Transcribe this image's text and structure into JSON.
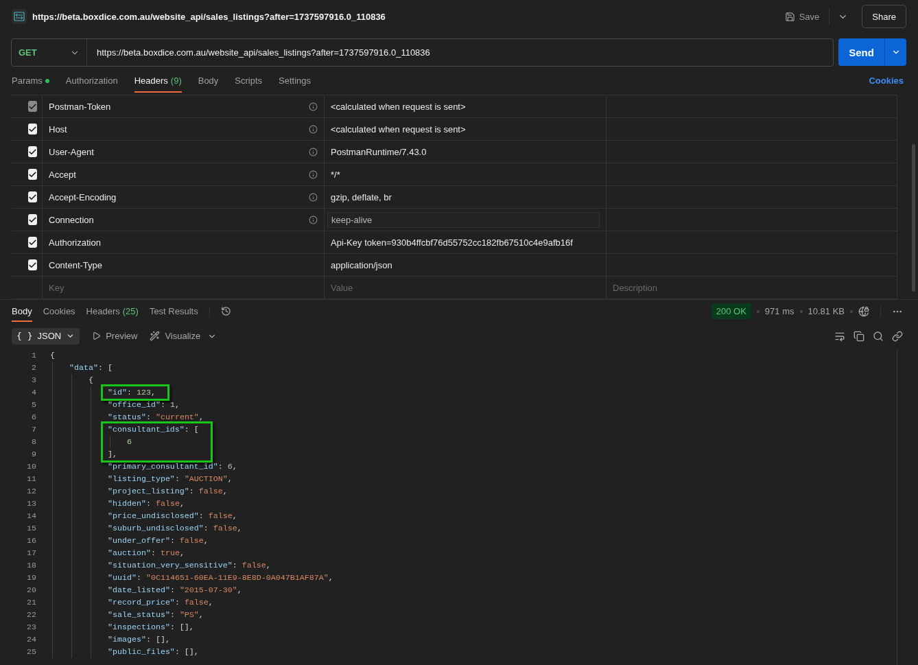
{
  "request_title": {
    "url": "https://beta.boxdice.com.au/website_api/sales_listings?after=1737597916.0_110836"
  },
  "actions": {
    "save": "Save",
    "share": "Share"
  },
  "url_bar": {
    "method": "GET",
    "url": "https://beta.boxdice.com.au/website_api/sales_listings?after=1737597916.0_110836",
    "send": "Send"
  },
  "request_tabs": [
    {
      "label": "Params",
      "dot": true,
      "selected": false
    },
    {
      "label": "Authorization",
      "dot": false,
      "selected": false
    },
    {
      "label": "Headers",
      "count": "(9)",
      "dot": false,
      "selected": true
    },
    {
      "label": "Body",
      "dot": false,
      "selected": false
    },
    {
      "label": "Scripts",
      "dot": false,
      "selected": false
    },
    {
      "label": "Settings",
      "dot": false,
      "selected": false
    }
  ],
  "cookies_link": "Cookies",
  "headers_table": {
    "rows": [
      {
        "checked": true,
        "disabled": true,
        "key": "Postman-Token",
        "info": true,
        "value": "<calculated when request is sent>",
        "editing": false
      },
      {
        "checked": true,
        "disabled": false,
        "key": "Host",
        "info": true,
        "value": "<calculated when request is sent>",
        "editing": false
      },
      {
        "checked": true,
        "disabled": false,
        "key": "User-Agent",
        "info": true,
        "value": "PostmanRuntime/7.43.0",
        "editing": false
      },
      {
        "checked": true,
        "disabled": false,
        "key": "Accept",
        "info": true,
        "value": "*/*",
        "editing": false
      },
      {
        "checked": true,
        "disabled": false,
        "key": "Accept-Encoding",
        "info": true,
        "value": "gzip, deflate, br",
        "editing": false
      },
      {
        "checked": true,
        "disabled": false,
        "key": "Connection",
        "info": true,
        "value": "keep-alive",
        "editing": true
      },
      {
        "checked": true,
        "disabled": false,
        "key": "Authorization",
        "info": false,
        "value": "Api-Key token=930b4ffcbf76d55752cc182fb67510c4e9afb16f",
        "editing": false
      },
      {
        "checked": true,
        "disabled": false,
        "key": "Content-Type",
        "info": false,
        "value": "application/json",
        "editing": false
      }
    ],
    "placeholders": {
      "key": "Key",
      "value": "Value",
      "description": "Description"
    }
  },
  "response_tabs": [
    {
      "label": "Body",
      "selected": true
    },
    {
      "label": "Cookies",
      "selected": false
    },
    {
      "label": "Headers",
      "count": "(25)",
      "selected": false
    },
    {
      "label": "Test Results",
      "selected": false
    }
  ],
  "response_status": {
    "code": "200 OK",
    "time": "971 ms",
    "size": "10.81 KB"
  },
  "view_toolbar": {
    "format_glyph": "{ }",
    "format": "JSON",
    "preview": "Preview",
    "visualize": "Visualize"
  },
  "code_lines": [
    {
      "number": "1",
      "boxed": false,
      "tokens": [
        {
          "kind": "punct",
          "text": "{"
        }
      ]
    },
    {
      "number": "2",
      "boxed": false,
      "tokens": [
        {
          "kind": "key",
          "text": "    \"data\""
        },
        {
          "kind": "punct",
          "text": ": ["
        }
      ]
    },
    {
      "number": "3",
      "boxed": false,
      "tokens": [
        {
          "kind": "punct",
          "text": "        {"
        }
      ]
    },
    {
      "number": "4",
      "boxed": true,
      "tokens": [
        {
          "kind": "key",
          "text": "            \"id\""
        },
        {
          "kind": "punct",
          "text": ": "
        },
        {
          "kind": "number",
          "text": "123"
        },
        {
          "kind": "punct",
          "text": ","
        }
      ]
    },
    {
      "number": "5",
      "boxed": false,
      "tokens": [
        {
          "kind": "key",
          "text": "            \"office_id\""
        },
        {
          "kind": "punct",
          "text": ": "
        },
        {
          "kind": "number",
          "text": "1"
        },
        {
          "kind": "punct",
          "text": ","
        }
      ]
    },
    {
      "number": "6",
      "boxed": false,
      "tokens": [
        {
          "kind": "key",
          "text": "            \"status\""
        },
        {
          "kind": "punct",
          "text": ": "
        },
        {
          "kind": "string",
          "text": "\"current\""
        },
        {
          "kind": "punct",
          "text": ","
        }
      ]
    },
    {
      "number": "7",
      "boxed": true,
      "tokens": [
        {
          "kind": "key",
          "text": "            \"consultant_ids\""
        },
        {
          "kind": "punct",
          "text": ": ["
        }
      ]
    },
    {
      "number": "8",
      "boxed": true,
      "tokens": [
        {
          "kind": "number",
          "text": "                6"
        }
      ]
    },
    {
      "number": "9",
      "boxed": true,
      "tokens": [
        {
          "kind": "punct",
          "text": "            ],"
        }
      ]
    },
    {
      "number": "10",
      "boxed": false,
      "tokens": [
        {
          "kind": "key",
          "text": "            \"primary_consultant_id\""
        },
        {
          "kind": "punct",
          "text": ": "
        },
        {
          "kind": "number",
          "text": "6"
        },
        {
          "kind": "punct",
          "text": ","
        }
      ]
    },
    {
      "number": "11",
      "boxed": false,
      "tokens": [
        {
          "kind": "key",
          "text": "            \"listing_type\""
        },
        {
          "kind": "punct",
          "text": ": "
        },
        {
          "kind": "string",
          "text": "\"AUCTION\""
        },
        {
          "kind": "punct",
          "text": ","
        }
      ]
    },
    {
      "number": "12",
      "boxed": false,
      "tokens": [
        {
          "kind": "key",
          "text": "            \"project_listing\""
        },
        {
          "kind": "punct",
          "text": ": "
        },
        {
          "kind": "literal",
          "text": "false"
        },
        {
          "kind": "punct",
          "text": ","
        }
      ]
    },
    {
      "number": "13",
      "boxed": false,
      "tokens": [
        {
          "kind": "key",
          "text": "            \"hidden\""
        },
        {
          "kind": "punct",
          "text": ": "
        },
        {
          "kind": "literal",
          "text": "false"
        },
        {
          "kind": "punct",
          "text": ","
        }
      ]
    },
    {
      "number": "14",
      "boxed": false,
      "tokens": [
        {
          "kind": "key",
          "text": "            \"price_undisclosed\""
        },
        {
          "kind": "punct",
          "text": ": "
        },
        {
          "kind": "literal",
          "text": "false"
        },
        {
          "kind": "punct",
          "text": ","
        }
      ]
    },
    {
      "number": "15",
      "boxed": false,
      "tokens": [
        {
          "kind": "key",
          "text": "            \"suburb_undisclosed\""
        },
        {
          "kind": "punct",
          "text": ": "
        },
        {
          "kind": "literal",
          "text": "false"
        },
        {
          "kind": "punct",
          "text": ","
        }
      ]
    },
    {
      "number": "16",
      "boxed": false,
      "tokens": [
        {
          "kind": "key",
          "text": "            \"under_offer\""
        },
        {
          "kind": "punct",
          "text": ": "
        },
        {
          "kind": "literal",
          "text": "false"
        },
        {
          "kind": "punct",
          "text": ","
        }
      ]
    },
    {
      "number": "17",
      "boxed": false,
      "tokens": [
        {
          "kind": "key",
          "text": "            \"auction\""
        },
        {
          "kind": "punct",
          "text": ": "
        },
        {
          "kind": "literal",
          "text": "true"
        },
        {
          "kind": "punct",
          "text": ","
        }
      ]
    },
    {
      "number": "18",
      "boxed": false,
      "tokens": [
        {
          "kind": "key",
          "text": "            \"situation_very_sensitive\""
        },
        {
          "kind": "punct",
          "text": ": "
        },
        {
          "kind": "literal",
          "text": "false"
        },
        {
          "kind": "punct",
          "text": ","
        }
      ]
    },
    {
      "number": "19",
      "boxed": false,
      "tokens": [
        {
          "kind": "key",
          "text": "            \"uuid\""
        },
        {
          "kind": "punct",
          "text": ": "
        },
        {
          "kind": "string",
          "text": "\"0C114651-60EA-11E9-8E8D-0A047B1AF87A\""
        },
        {
          "kind": "punct",
          "text": ","
        }
      ]
    },
    {
      "number": "20",
      "boxed": false,
      "tokens": [
        {
          "kind": "key",
          "text": "            \"date_listed\""
        },
        {
          "kind": "punct",
          "text": ": "
        },
        {
          "kind": "string",
          "text": "\"2015-07-30\""
        },
        {
          "kind": "punct",
          "text": ","
        }
      ]
    },
    {
      "number": "21",
      "boxed": false,
      "tokens": [
        {
          "kind": "key",
          "text": "            \"record_price\""
        },
        {
          "kind": "punct",
          "text": ": "
        },
        {
          "kind": "literal",
          "text": "false"
        },
        {
          "kind": "punct",
          "text": ","
        }
      ]
    },
    {
      "number": "22",
      "boxed": false,
      "tokens": [
        {
          "kind": "key",
          "text": "            \"sale_status\""
        },
        {
          "kind": "punct",
          "text": ": "
        },
        {
          "kind": "string",
          "text": "\"PS\""
        },
        {
          "kind": "punct",
          "text": ","
        }
      ]
    },
    {
      "number": "23",
      "boxed": false,
      "tokens": [
        {
          "kind": "key",
          "text": "            \"inspections\""
        },
        {
          "kind": "punct",
          "text": ": [],"
        }
      ]
    },
    {
      "number": "24",
      "boxed": false,
      "tokens": [
        {
          "kind": "key",
          "text": "            \"images\""
        },
        {
          "kind": "punct",
          "text": ": [],"
        }
      ]
    },
    {
      "number": "25",
      "boxed": false,
      "tokens": [
        {
          "kind": "key",
          "text": "            \"public_files\""
        },
        {
          "kind": "punct",
          "text": ": [],"
        }
      ]
    }
  ]
}
